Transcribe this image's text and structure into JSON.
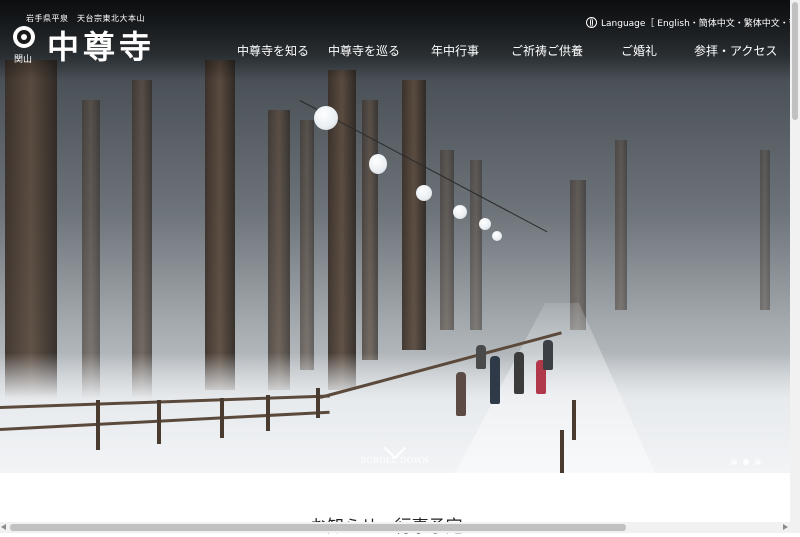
{
  "header": {
    "subtitle": "岩手県平泉　天台宗東北大本山",
    "mountain_name": "関山",
    "logo_title": "中尊寺",
    "language_label": "Language［ English・簡体中文・繁体中文・한국어 ］"
  },
  "nav": {
    "items": [
      {
        "label": "中尊寺を知る"
      },
      {
        "label": "中尊寺を巡る"
      },
      {
        "label": "年中行事"
      },
      {
        "label": "ご祈祷ご供養"
      },
      {
        "label": "ご婚礼"
      },
      {
        "label": "参拝・アクセス"
      }
    ]
  },
  "hero": {
    "scroll_label": "SCROLL DOWN",
    "slides": {
      "count": 3,
      "active": 2
    }
  },
  "main": {
    "section_title": "お知らせ・行事予定"
  },
  "icons": {
    "language": "globe-icon",
    "scroll": "chevron-down-icon",
    "crest": "crest-icon"
  },
  "colors": {
    "text_on_hero": "#ffffff",
    "page_background": "#ffffff"
  }
}
